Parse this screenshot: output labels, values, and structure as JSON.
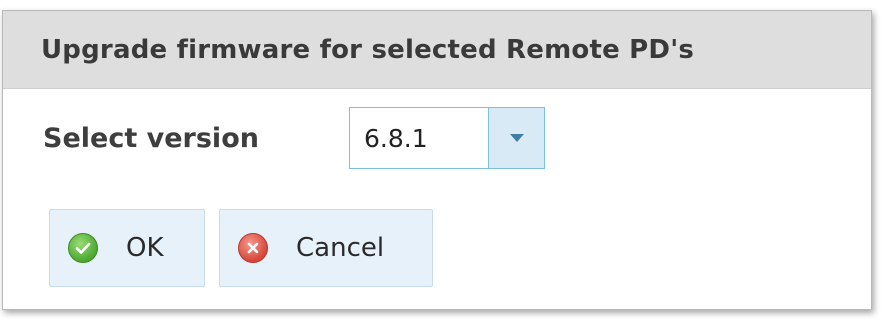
{
  "dialog": {
    "title": "Upgrade firmware for selected Remote PD's",
    "version_label": "Select version",
    "version_select": {
      "selected_value": "6.8.1"
    },
    "buttons": {
      "ok_label": "OK",
      "cancel_label": "Cancel"
    }
  },
  "icons": {
    "ok": "checkmark-circle-icon",
    "cancel": "close-circle-icon",
    "dropdown": "chevron-down-icon"
  },
  "colors": {
    "titlebar_bg": "#dedede",
    "button_bg": "#e7f1f9",
    "select_border": "#7cc0de",
    "ok_icon": "#4aa82f",
    "cancel_icon": "#d6463a"
  }
}
